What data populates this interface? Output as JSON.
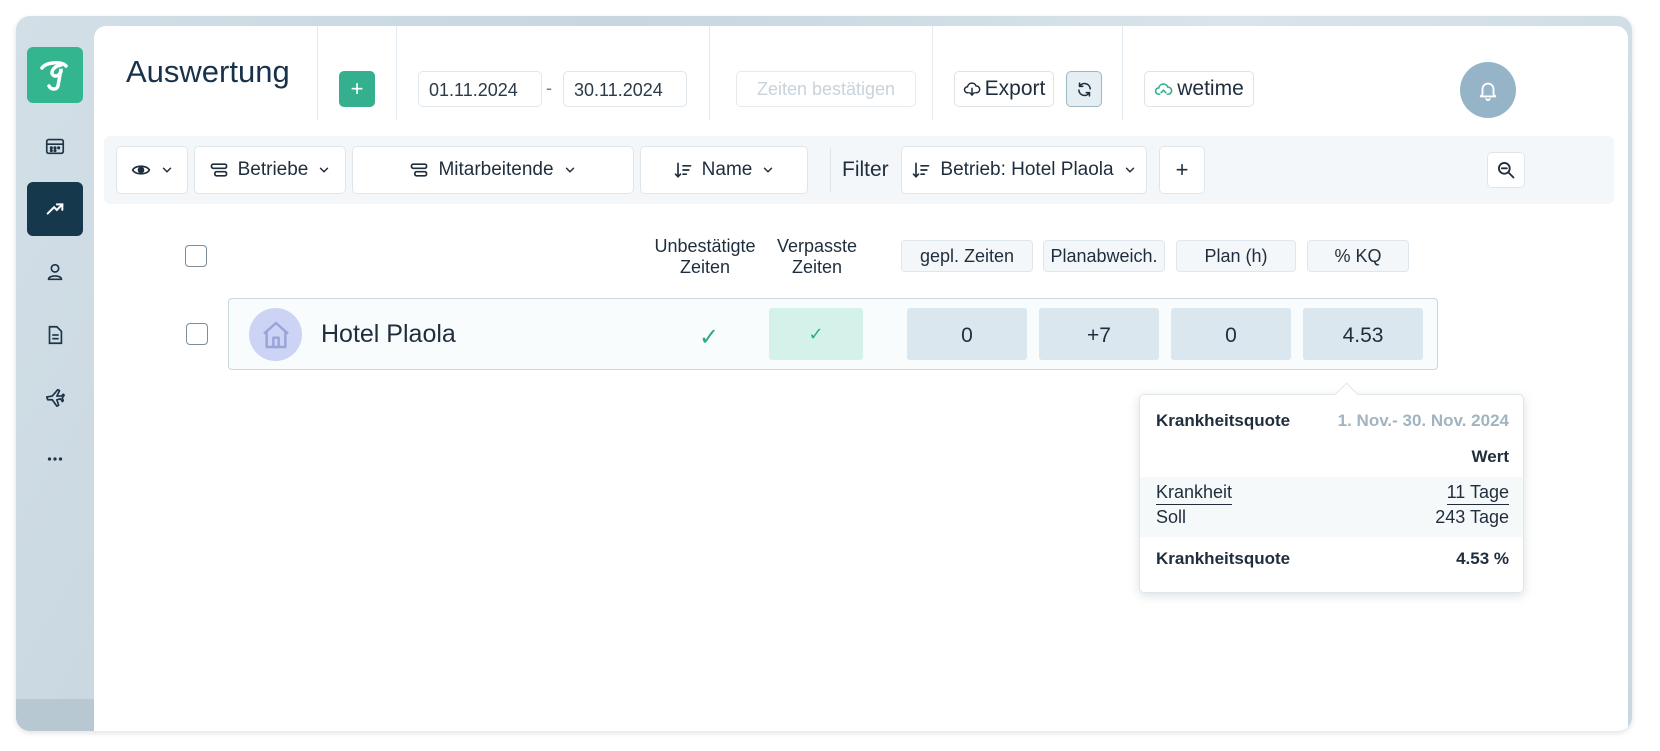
{
  "header": {
    "title": "Auswertung",
    "add_label": "+",
    "date_from": "01.11.2024",
    "date_sep": "-",
    "date_to": "30.11.2024",
    "confirm_label": "Zeiten bestätigen",
    "export_label": "Export",
    "wetime_label": "wetime"
  },
  "toolbar": {
    "groups": [
      "Betriebe",
      "Mitarbeitende"
    ],
    "sort_label": "Name",
    "filter_label": "Filter",
    "filter_chip": "Betrieb: Hotel Plaola",
    "add_filter_label": "+"
  },
  "table": {
    "headers": {
      "unconfirmed_line1": "Unbestätigte",
      "unconfirmed_line2": "Zeiten",
      "missed_line1": "Verpasste",
      "missed_line2": "Zeiten",
      "planned": "gepl. Zeiten",
      "deviation": "Planabweich.",
      "plan_hours": "Plan (h)",
      "kq": "% KQ"
    },
    "rows": [
      {
        "name": "Hotel Plaola",
        "unconfirmed": "✓",
        "missed": "✓",
        "planned": "0",
        "deviation": "+7",
        "plan_hours": "0",
        "kq": "4.53"
      }
    ]
  },
  "tooltip": {
    "title": "Krankheitsquote",
    "date_range": "1. Nov.- 30. Nov. 2024",
    "column": "Wert",
    "sick_label": "Krankheit",
    "sick_value": "11 Tage",
    "target_label": "Soll",
    "target_value": "243 Tage",
    "total_label": "Krankheitsquote",
    "total_value": "4.53 %"
  },
  "colors": {
    "brand": "#33b58f",
    "nav_active": "#16384d",
    "accent_button": "#34b08e",
    "check": "#2daa86",
    "cell_bg": "#dbe7ee"
  },
  "icons": [
    "logo-icon",
    "calendar-icon",
    "trending-up-icon",
    "user-icon",
    "document-icon",
    "airplane-icon",
    "more-icon",
    "cloud-download-icon",
    "refresh-icon",
    "cloud-icon",
    "bell-icon",
    "eye-icon",
    "chevron-down-icon",
    "group-icon",
    "sort-icon",
    "zoom-out-icon",
    "home-icon"
  ]
}
